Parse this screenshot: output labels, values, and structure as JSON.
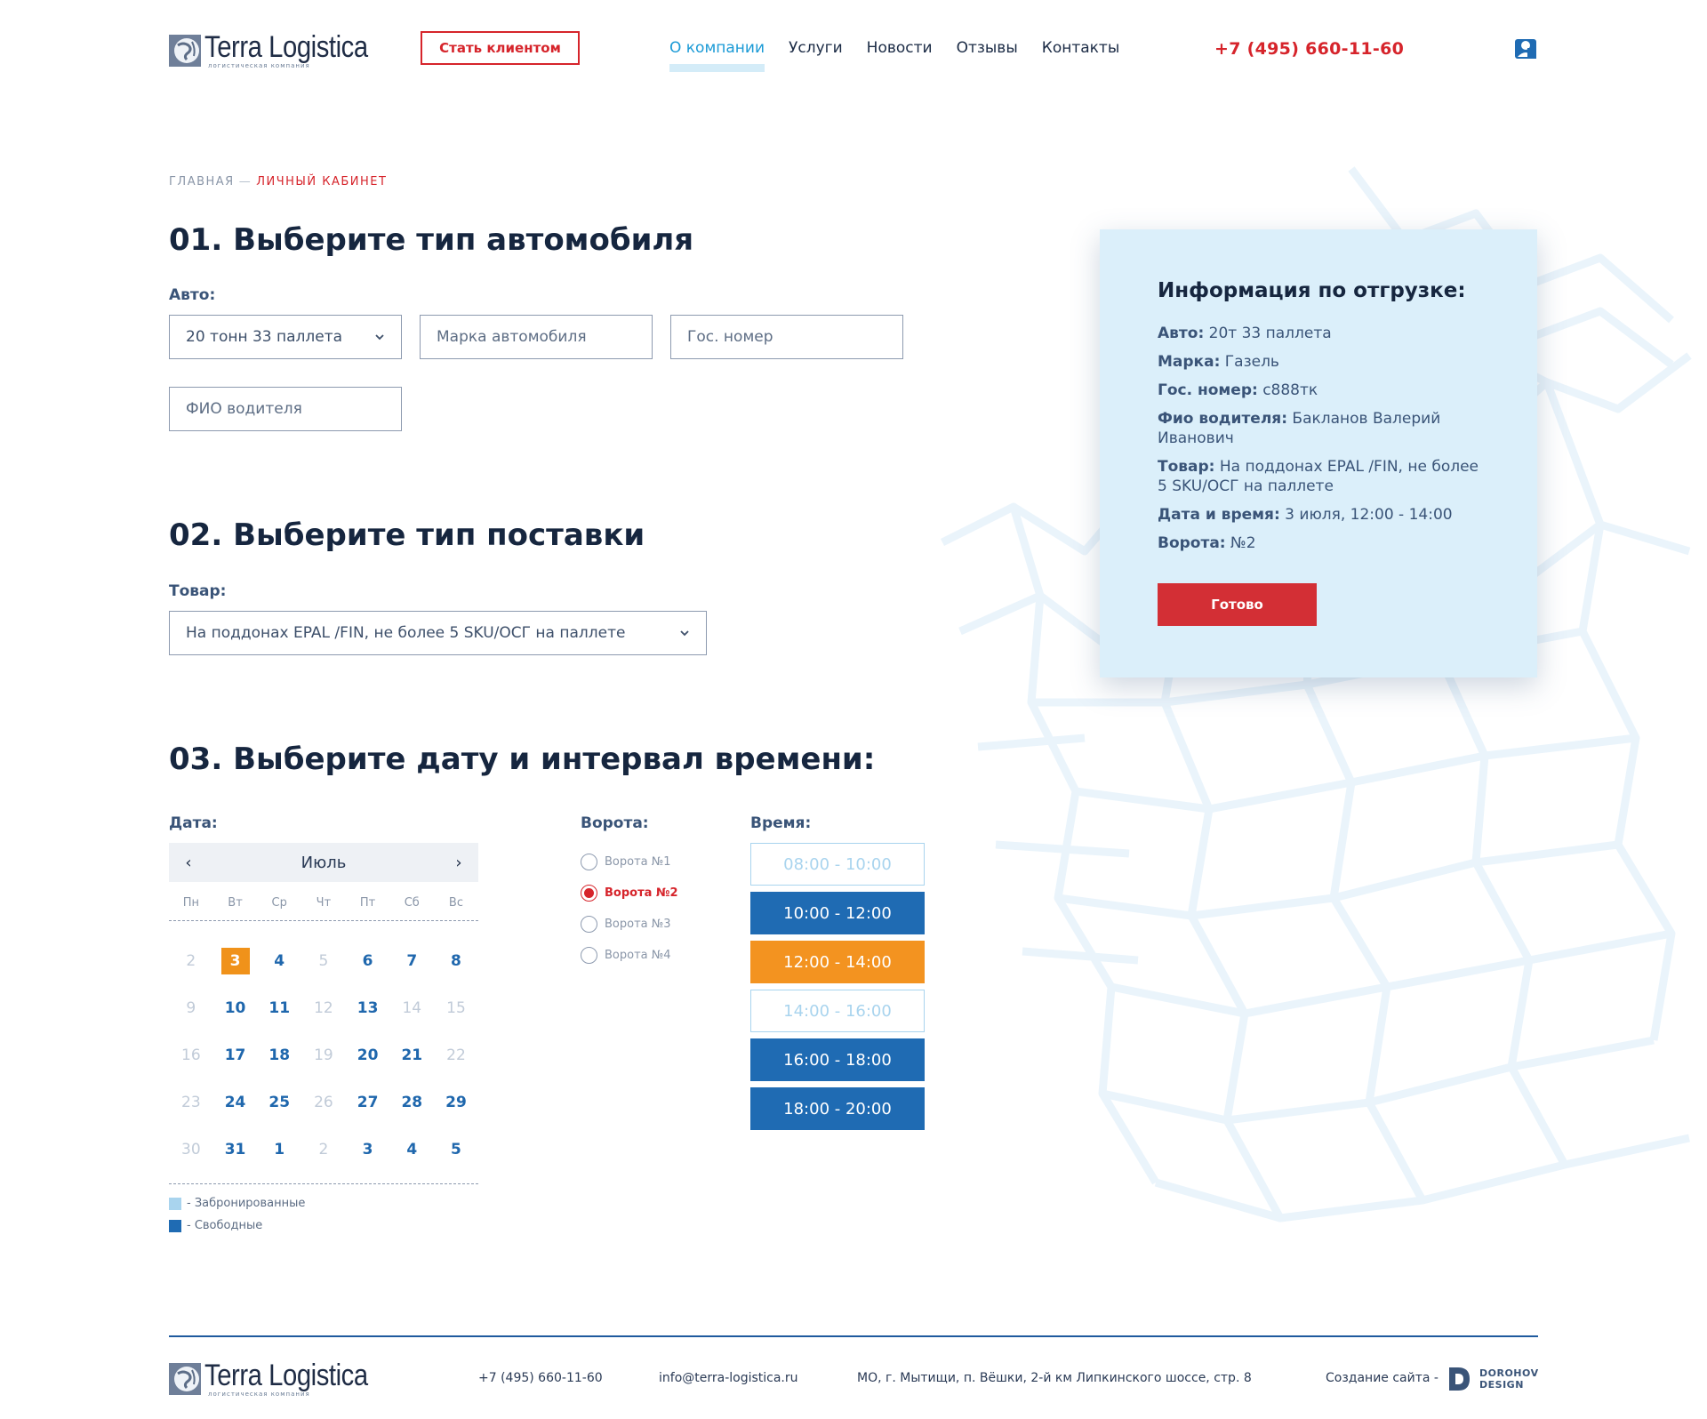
{
  "header": {
    "logo_text": "Terra Logistica",
    "logo_subtitle": "логистическая компания",
    "client_button": "Стать клиентом",
    "nav": [
      "О компании",
      "Услуги",
      "Новости",
      "Отзывы",
      "Контакты"
    ],
    "phone": "+7 (495) 660-11-60",
    "account_icon": "user-account-icon"
  },
  "breadcrumb": {
    "home": "ГЛАВНАЯ",
    "separator": "—",
    "current": "ЛИЧНЫЙ КАБИНЕТ"
  },
  "step1": {
    "title": "01. Выберите тип автомобиля",
    "label": "Авто:",
    "car_type_value": "20 тонн 33 паллета",
    "brand_placeholder": "Марка автомобиля",
    "plate_placeholder": "Гос. номер",
    "driver_placeholder": "ФИО водителя"
  },
  "step2": {
    "title": "02. Выберите тип поставки",
    "label": "Товар:",
    "goods_value": "На поддонах EPAL /FIN, не более 5 SKU/ОСГ на паллете"
  },
  "step3": {
    "title": "03. Выберите дату и интервал времени:",
    "date_label": "Дата:",
    "gates_label": "Ворота:",
    "time_label": "Время:"
  },
  "calendar": {
    "month": "Июль",
    "prev": "‹",
    "next": "›",
    "weekdays": [
      "Пн",
      "Вт",
      "Ср",
      "Чт",
      "Пт",
      "Сб",
      "Вс"
    ],
    "weeks": [
      [
        {
          "d": "2",
          "s": "inactive"
        },
        {
          "d": "3",
          "s": "selected"
        },
        {
          "d": "4",
          "s": "active"
        },
        {
          "d": "5",
          "s": "inactive"
        },
        {
          "d": "6",
          "s": "active"
        },
        {
          "d": "7",
          "s": "active"
        },
        {
          "d": "8",
          "s": "active"
        }
      ],
      [
        {
          "d": "9",
          "s": "inactive"
        },
        {
          "d": "10",
          "s": "active"
        },
        {
          "d": "11",
          "s": "active"
        },
        {
          "d": "12",
          "s": "inactive"
        },
        {
          "d": "13",
          "s": "active"
        },
        {
          "d": "14",
          "s": "inactive"
        },
        {
          "d": "15",
          "s": "inactive"
        }
      ],
      [
        {
          "d": "16",
          "s": "inactive"
        },
        {
          "d": "17",
          "s": "active"
        },
        {
          "d": "18",
          "s": "active"
        },
        {
          "d": "19",
          "s": "inactive"
        },
        {
          "d": "20",
          "s": "active"
        },
        {
          "d": "21",
          "s": "active"
        },
        {
          "d": "22",
          "s": "inactive"
        }
      ],
      [
        {
          "d": "23",
          "s": "inactive"
        },
        {
          "d": "24",
          "s": "active"
        },
        {
          "d": "25",
          "s": "active"
        },
        {
          "d": "26",
          "s": "inactive"
        },
        {
          "d": "27",
          "s": "active"
        },
        {
          "d": "28",
          "s": "active"
        },
        {
          "d": "29",
          "s": "active"
        }
      ],
      [
        {
          "d": "30",
          "s": "inactive"
        },
        {
          "d": "31",
          "s": "active"
        },
        {
          "d": "1",
          "s": "active"
        },
        {
          "d": "2",
          "s": "inactive"
        },
        {
          "d": "3",
          "s": "active"
        },
        {
          "d": "4",
          "s": "active"
        },
        {
          "d": "5",
          "s": "active"
        }
      ]
    ],
    "legend": {
      "booked": "- Забронированные",
      "free": "- Свободные"
    }
  },
  "gates": [
    {
      "label": "Ворота №1",
      "checked": false
    },
    {
      "label": "Ворота №2",
      "checked": true
    },
    {
      "label": "Ворота №3",
      "checked": false
    },
    {
      "label": "Ворота №4",
      "checked": false
    }
  ],
  "time_slots": [
    {
      "label": "08:00 - 10:00",
      "state": "booked"
    },
    {
      "label": "10:00 - 12:00",
      "state": "free"
    },
    {
      "label": "12:00 - 14:00",
      "state": "selected"
    },
    {
      "label": "14:00 - 16:00",
      "state": "booked"
    },
    {
      "label": "16:00 - 18:00",
      "state": "free"
    },
    {
      "label": "18:00 - 20:00",
      "state": "free"
    }
  ],
  "summary": {
    "title": "Информация по отгрузке:",
    "rows": [
      {
        "key": "Авто:",
        "value": "20т 33 паллета"
      },
      {
        "key": "Марка:",
        "value": "Газель"
      },
      {
        "key": "Гос. номер:",
        "value": "с888тк"
      },
      {
        "key": "Фио водителя:",
        "value": "Бакланов Валерий Иванович"
      },
      {
        "key": "Товар:",
        "value": "На поддонах EPAL /FIN, не более 5 SKU/ОСГ на паллете"
      },
      {
        "key": "Дата и время:",
        "value": "3 июля, 12:00 - 14:00"
      },
      {
        "key": "Ворота:",
        "value": "№2"
      }
    ],
    "button": "Готово"
  },
  "footer": {
    "logo_text": "Terra Logistica",
    "logo_subtitle": "логистическая компания",
    "phone": "+7 (495) 660-11-60",
    "email": "info@terra-logistica.ru",
    "address": "МО, г. Мытищи, п. Вёшки, 2-й км Липкинского шоссе, стр. 8",
    "credit": "Создание сайта -",
    "studio_line1": "DOROHOV",
    "studio_line2": "DESIGN"
  },
  "colors": {
    "accent_red": "#d6242b",
    "nav_active": "#1a9ad6",
    "slot_free": "#1f6bb3",
    "slot_selected": "#f39320",
    "slot_booked_border": "#a9d4ee",
    "panel_bg": "#dbeffa"
  }
}
